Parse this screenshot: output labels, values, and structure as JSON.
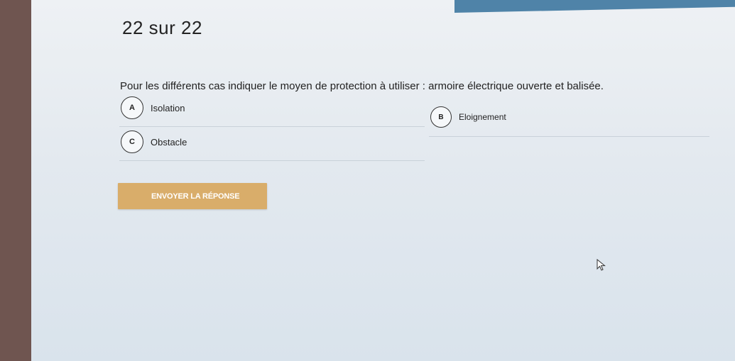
{
  "quiz": {
    "counter": "22 sur 22",
    "question": "Pour les différents cas indiquer le moyen de protection à utiliser : armoire électrique ouverte et balisée.",
    "options": [
      {
        "letter": "A",
        "label": "Isolation"
      },
      {
        "letter": "B",
        "label": "Eloignement"
      },
      {
        "letter": "C",
        "label": "Obstacle"
      }
    ],
    "submit_label": "ENVOYER LA RÉPONSE"
  },
  "colors": {
    "submit_bg": "#d9ad6a",
    "screen_bg": "#e3e9ef",
    "top_strip": "#4f83a8"
  }
}
